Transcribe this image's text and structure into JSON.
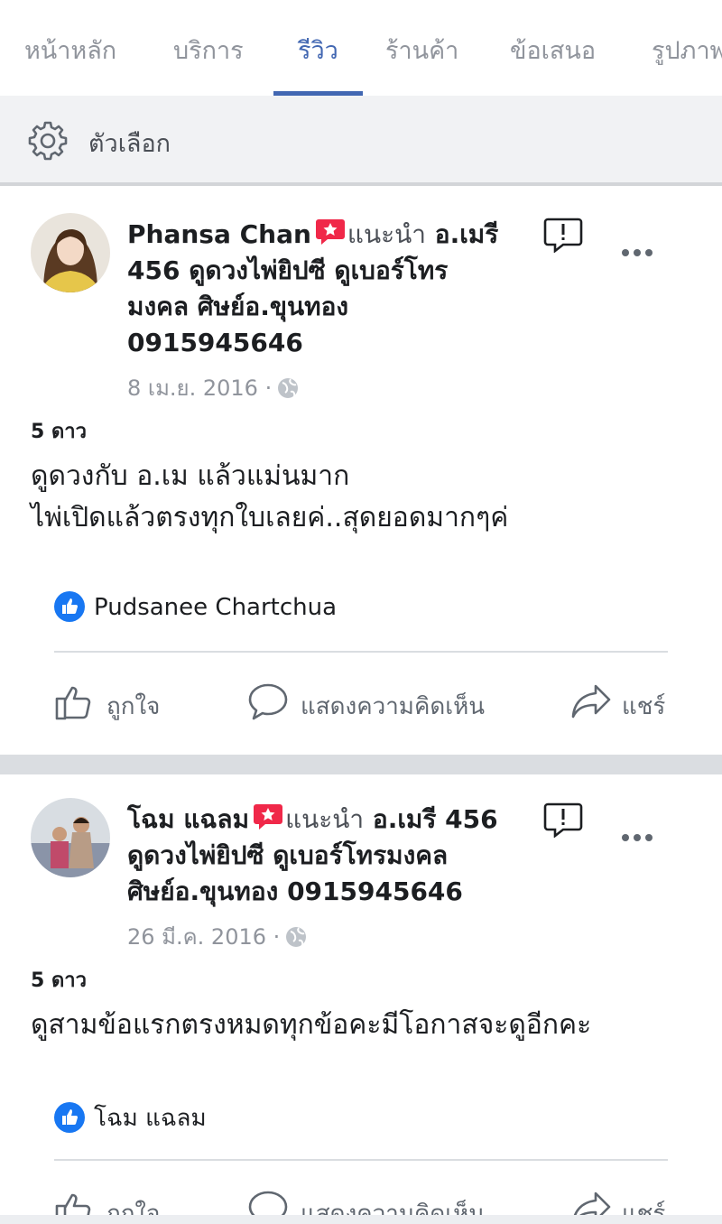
{
  "tabs": [
    {
      "label": "หน้าหลัก"
    },
    {
      "label": "บริการ"
    },
    {
      "label": "รีวิว"
    },
    {
      "label": "ร้านค้า"
    },
    {
      "label": "ข้อเสนอ"
    },
    {
      "label": "รูปภาพ"
    }
  ],
  "options": {
    "label": "ตัวเลือก",
    "icon": "gear-icon"
  },
  "colors": {
    "accent": "#4267b2",
    "badge": "#f02849",
    "like": "#1877f2"
  },
  "reviews": [
    {
      "author": "Phansa Chan",
      "recommends": "แนะนำ",
      "page_line1": "อ.เมรี",
      "page_line2": "456 ดูดวงไพ่ยิปซี ดูเบอร์โทร",
      "page_line3": "มงคล ศิษย์อ.ขุนทอง",
      "page_line4": "0915945646",
      "date": "8 เม.ย. 2016 ·",
      "rating": "5 ดาว",
      "text_line1": "ดูดวงกับ อ.เม แล้วแม่นมาก",
      "text_line2": "ไพ่เปิดแล้วตรงทุกใบเลยค่..สุดยอดมากๆค่",
      "liked_by": "Pudsanee Chartchua"
    },
    {
      "author": "โฉม แฉลม",
      "recommends": "แนะนำ",
      "page_line1": "อ.เมรี 456",
      "page_line2": "ดูดวงไพ่ยิปซี ดูเบอร์โทรมงคล",
      "page_line3": "ศิษย์อ.ขุนทอง 0915945646",
      "date": "26 มี.ค. 2016 ·",
      "rating": "5 ดาว",
      "text_line1": "ดูสามข้อแรกตรงหมดทุกข้อคะมีโอกาสจะดูอีกคะ",
      "liked_by": "โฉม แฉลม"
    }
  ],
  "actions": {
    "like": "ถูกใจ",
    "comment": "แสดงความคิดเห็น",
    "share": "แชร์"
  }
}
